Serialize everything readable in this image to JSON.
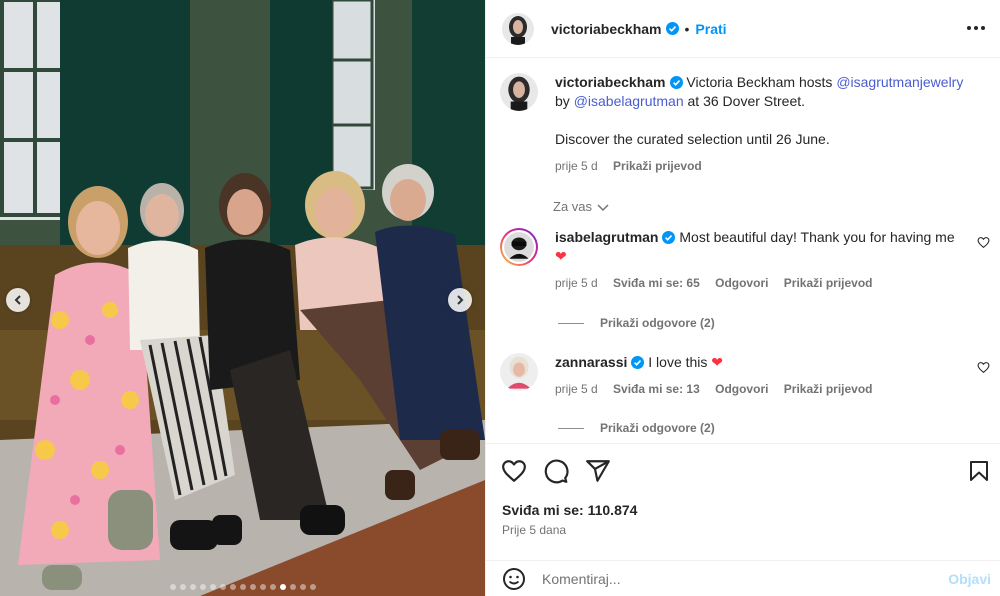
{
  "post": {
    "author": "victoriabeckham",
    "follow_label": "Prati",
    "bullet": "•",
    "verified": true
  },
  "caption": {
    "author": "victoriabeckham",
    "text_1": "Victoria Beckham hosts ",
    "mention_1": "@isagrutmanjewelry",
    "text_2": "by ",
    "mention_2": "@isabelagrutman",
    "text_3": " at 36 Dover Street.",
    "text_4": "Discover the curated selection until 26 June.",
    "time": "prije 5 d",
    "translate": "Prikaži prijevod"
  },
  "for_you": "Za vas",
  "comments": [
    {
      "user": "isabelagrutman",
      "text": "Most beautiful day! Thank you for having me",
      "emoji": "❤",
      "time": "prije 5 d",
      "likes": "Sviđa mi se: 65",
      "reply": "Odgovori",
      "translate": "Prikaži prijevod",
      "view_replies": "Prikaži odgovore (2)"
    },
    {
      "user": "zannarassi",
      "text": "I love this",
      "emoji": "❤",
      "time": "prije 5 d",
      "likes": "Sviđa mi se: 13",
      "reply": "Odgovori",
      "translate": "Prikaži prijevod",
      "view_replies": "Prikaži odgovore (2)"
    }
  ],
  "actions": {
    "likes": "Sviđa mi se: 110.874",
    "date": "Prije 5 dana",
    "icons": [
      "heart-icon",
      "comment-icon",
      "share-icon",
      "bookmark-icon"
    ]
  },
  "composer": {
    "placeholder": "Komentiraj...",
    "post_label": "Objavi",
    "emoji_icon": "smiley-icon"
  },
  "carousel": {
    "total": 15,
    "active_index": 11
  },
  "colors": {
    "link": "#00376b",
    "accent": "#0095f6",
    "muted": "#737373",
    "heart": "#ff3040",
    "post_disabled": "#b2dffc"
  }
}
